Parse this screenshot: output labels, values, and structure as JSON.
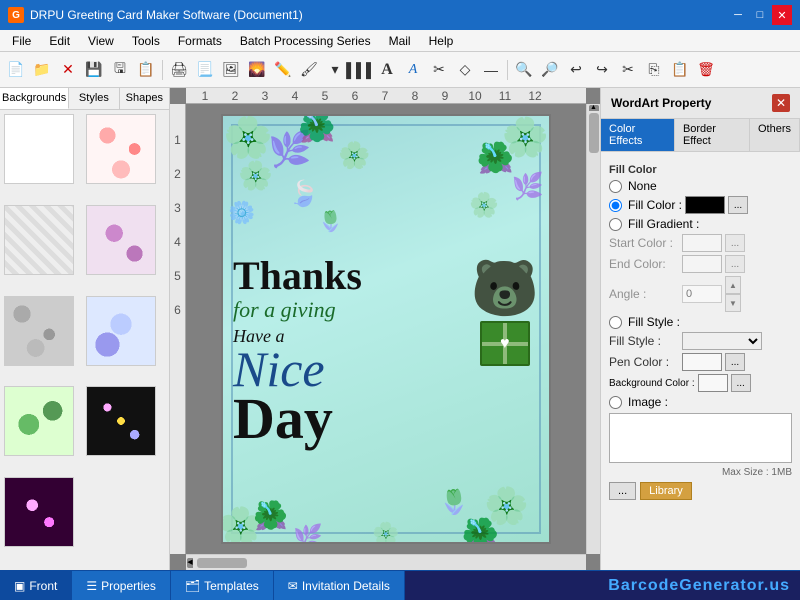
{
  "titlebar": {
    "title": "DRPU Greeting Card Maker Software (Document1)",
    "controls": [
      "minimize",
      "maximize",
      "close"
    ]
  },
  "menubar": {
    "items": [
      "File",
      "Edit",
      "View",
      "Tools",
      "Formats",
      "Batch Processing Series",
      "Mail",
      "Help"
    ]
  },
  "left_panel": {
    "tabs": [
      "Backgrounds",
      "Styles",
      "Shapes"
    ],
    "active_tab": "Backgrounds"
  },
  "right_panel": {
    "title": "WordArt Property",
    "tabs": [
      "Color Effects",
      "Border Effect",
      "Others"
    ],
    "active_tab": "Color Effects",
    "fill_color": {
      "label": "Fill Color",
      "options": [
        "None",
        "Fill Color :",
        "Fill Gradient :"
      ],
      "selected": "Fill Color :",
      "color_value": "#000000",
      "gradient": {
        "start_label": "Start Color :",
        "end_label": "End Color:",
        "angle_label": "Angle :",
        "angle_value": "0"
      }
    },
    "fill_style": {
      "label": "Fill Style :",
      "sub_label": "Fill Style :"
    },
    "pen_color": {
      "label": "Pen Color :"
    },
    "background_color": {
      "label": "Background Color :"
    },
    "image": {
      "label": "Image :",
      "max_size": "Max Size : 1MB"
    },
    "buttons": {
      "dots": "...",
      "library": "Library"
    }
  },
  "statusbar": {
    "buttons": [
      {
        "id": "front",
        "label": "Front",
        "icon": "front-icon",
        "active": true
      },
      {
        "id": "properties",
        "label": "Properties",
        "icon": "properties-icon",
        "active": false
      },
      {
        "id": "templates",
        "label": "Templates",
        "icon": "templates-icon",
        "active": false
      },
      {
        "id": "invitation",
        "label": "Invitation Details",
        "icon": "invitation-icon",
        "active": false
      }
    ],
    "barcode_text": "BarcodeGenerator.us"
  }
}
